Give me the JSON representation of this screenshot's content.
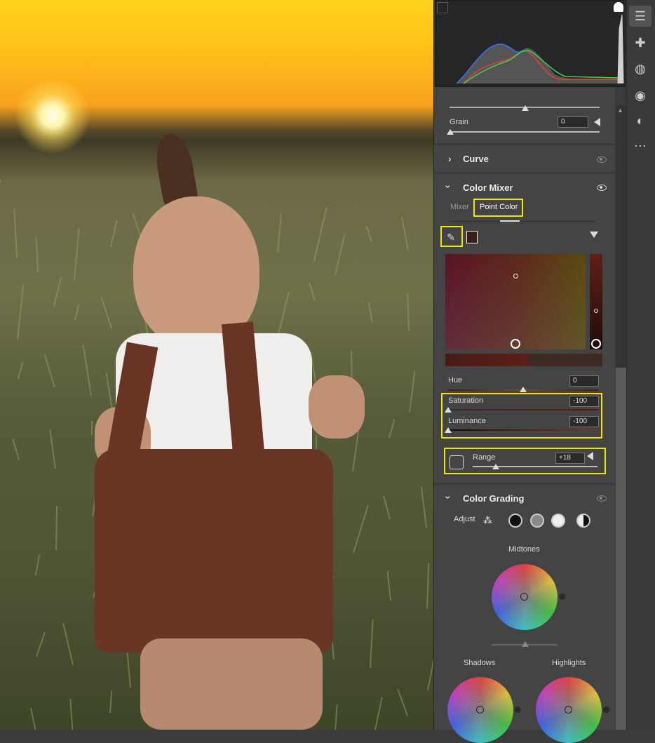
{
  "panel": {
    "grain": {
      "label": "Grain",
      "value": "0"
    },
    "curve": {
      "title": "Curve"
    },
    "color_mixer": {
      "title": "Color Mixer",
      "tabs": [
        {
          "label": "Mixer"
        },
        {
          "label": "Point Color"
        }
      ],
      "hue": {
        "label": "Hue",
        "value": "0"
      },
      "saturation": {
        "label": "Saturation",
        "value": "-100"
      },
      "luminance": {
        "label": "Luminance",
        "value": "-100"
      },
      "range": {
        "label": "Range",
        "value": "+18"
      }
    },
    "color_grading": {
      "title": "Color Grading",
      "adjust_label": "Adjust",
      "midtones": "Midtones",
      "shadows": "Shadows",
      "highlights": "Highlights"
    }
  },
  "toolbar": {
    "icons": [
      "edit-sliders-icon",
      "healing-icon",
      "mask-icon",
      "red-eye-icon",
      "presets-icon",
      "more-icon"
    ]
  },
  "colors": {
    "highlight": "#f2e600",
    "panel_bg": "#3b3b3b"
  }
}
